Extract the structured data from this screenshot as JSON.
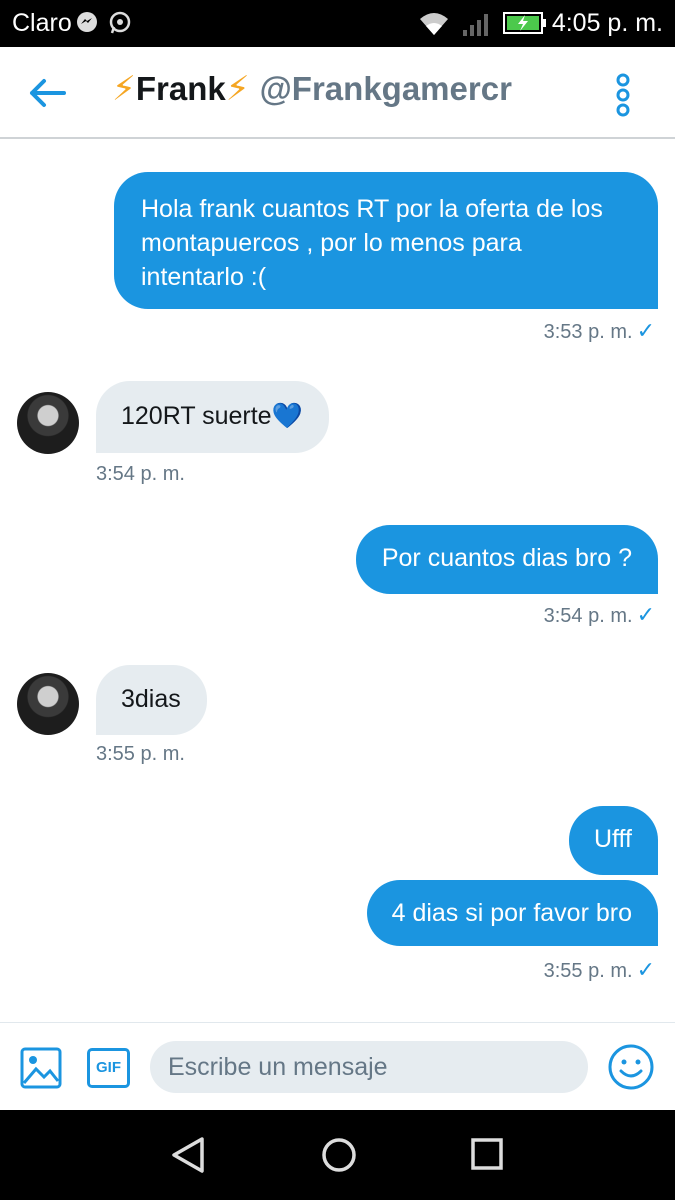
{
  "status_bar": {
    "carrier": "Claro",
    "time": "4:05 p. m.",
    "icons": [
      "messenger-icon",
      "whatsapp-icon",
      "wifi-icon",
      "signal-icon",
      "battery-charging-icon"
    ]
  },
  "header": {
    "name": "Frank",
    "emoji": "⚡",
    "handle": "@Frankgamercr",
    "icons": [
      "back-arrow-icon",
      "more-options-icon"
    ]
  },
  "messages": [
    {
      "direction": "out",
      "lines": [
        "Hola frank cuantos RT por la oferta de los",
        "montapuercos , por lo menos para",
        "intentarlo :("
      ],
      "time": "3:53 p. m.",
      "read": true
    },
    {
      "direction": "in",
      "text": "120RT suerte",
      "emoji": "💙",
      "time": "3:54 p. m."
    },
    {
      "direction": "out",
      "text": "Por cuantos dias bro ?",
      "time": "3:54 p. m.",
      "read": true
    },
    {
      "direction": "in",
      "text": "3dias",
      "time": "3:55 p. m."
    },
    {
      "direction": "out",
      "text": "Ufff"
    },
    {
      "direction": "out",
      "text": "4 dias si por favor bro",
      "time": "3:55 p. m.",
      "read": true
    }
  ],
  "compose": {
    "placeholder": "Escribe un mensaje",
    "gif_label": "GIF",
    "icons": [
      "image-icon",
      "gif-icon",
      "emoji-icon"
    ]
  },
  "nav_bar": {
    "icons": [
      "back-triangle-icon",
      "home-circle-icon",
      "recents-square-icon"
    ]
  },
  "colors": {
    "accent": "#1b95e0",
    "incoming_bubble": "#e6ecf0",
    "timestamp": "#657786",
    "bolt": "#f5a623"
  }
}
